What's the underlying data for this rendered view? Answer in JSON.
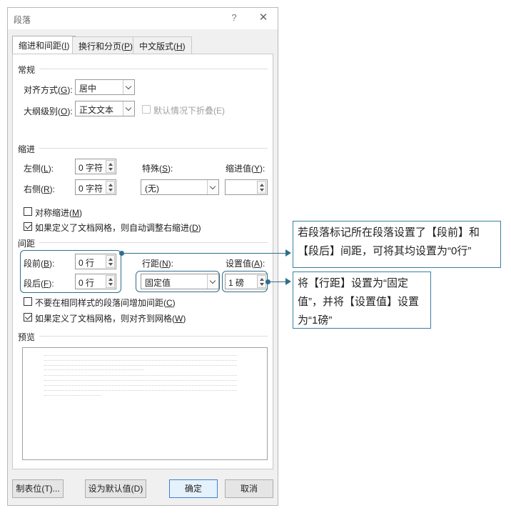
{
  "dialog": {
    "title": "段落",
    "help": "?",
    "close": "✕",
    "tabs": [
      {
        "label": "缩进和间距(",
        "key": "I",
        "suffix": ")"
      },
      {
        "label": "换行和分页(",
        "key": "P",
        "suffix": ")"
      },
      {
        "label": "中文版式(",
        "key": "H",
        "suffix": ")"
      }
    ]
  },
  "general": {
    "header": "常规",
    "alignment_label": "对齐方式(",
    "alignment_key": "G",
    "alignment_suffix": "):",
    "alignment_value": "居中",
    "outline_label": "大纲级别(",
    "outline_key": "O",
    "outline_suffix": "):",
    "outline_value": "正文文本",
    "collapse_label": "默认情况下折叠(E)"
  },
  "indent": {
    "header": "缩进",
    "left_label": "左侧(",
    "left_key": "L",
    "left_suffix": "):",
    "left_value": "0 字符",
    "right_label": "右侧(",
    "right_key": "R",
    "right_suffix": "):",
    "right_value": "0 字符",
    "special_label": "特殊(",
    "special_key": "S",
    "special_suffix": "):",
    "special_value": "(无)",
    "by_label": "缩进值(",
    "by_key": "Y",
    "by_suffix": "):",
    "by_value": "",
    "mirror_label": "对称缩进(",
    "mirror_key": "M",
    "mirror_suffix": ")",
    "auto_adjust_label": "如果定义了文档网格，则自动调整右缩进(",
    "auto_adjust_key": "D",
    "auto_adjust_suffix": ")"
  },
  "spacing": {
    "header": "间距",
    "before_label": "段前(",
    "before_key": "B",
    "before_suffix": "):",
    "before_value": "0 行",
    "after_label": "段后(",
    "after_key": "F",
    "after_suffix": "):",
    "after_value": "0 行",
    "line_label": "行距(",
    "line_key": "N",
    "line_suffix": "):",
    "line_value": "固定值",
    "at_label": "设置值(",
    "at_key": "A",
    "at_suffix": "):",
    "at_value": "1 磅",
    "no_space_label": "不要在相同样式的段落间增加间距(",
    "no_space_key": "C",
    "no_space_suffix": ")",
    "snap_grid_label": "如果定义了文档网格，则对齐到网格(",
    "snap_grid_key": "W",
    "snap_grid_suffix": ")"
  },
  "preview": {
    "header": "预览"
  },
  "buttons": {
    "tabs": "制表位(T)...",
    "set_default": "设为默认值(D)",
    "ok": "确定",
    "cancel": "取消"
  },
  "annotations": {
    "callout1": "若段落标记所在段落设置了【段前】和【段后】间距，可将其均设置为“0行”",
    "callout2": "将【行距】设置为“固定值”，并将【设置值】设置为“1磅”"
  },
  "colors": {
    "annotation": "#2f6e8e",
    "primary_button_border": "#3f7fd1"
  }
}
